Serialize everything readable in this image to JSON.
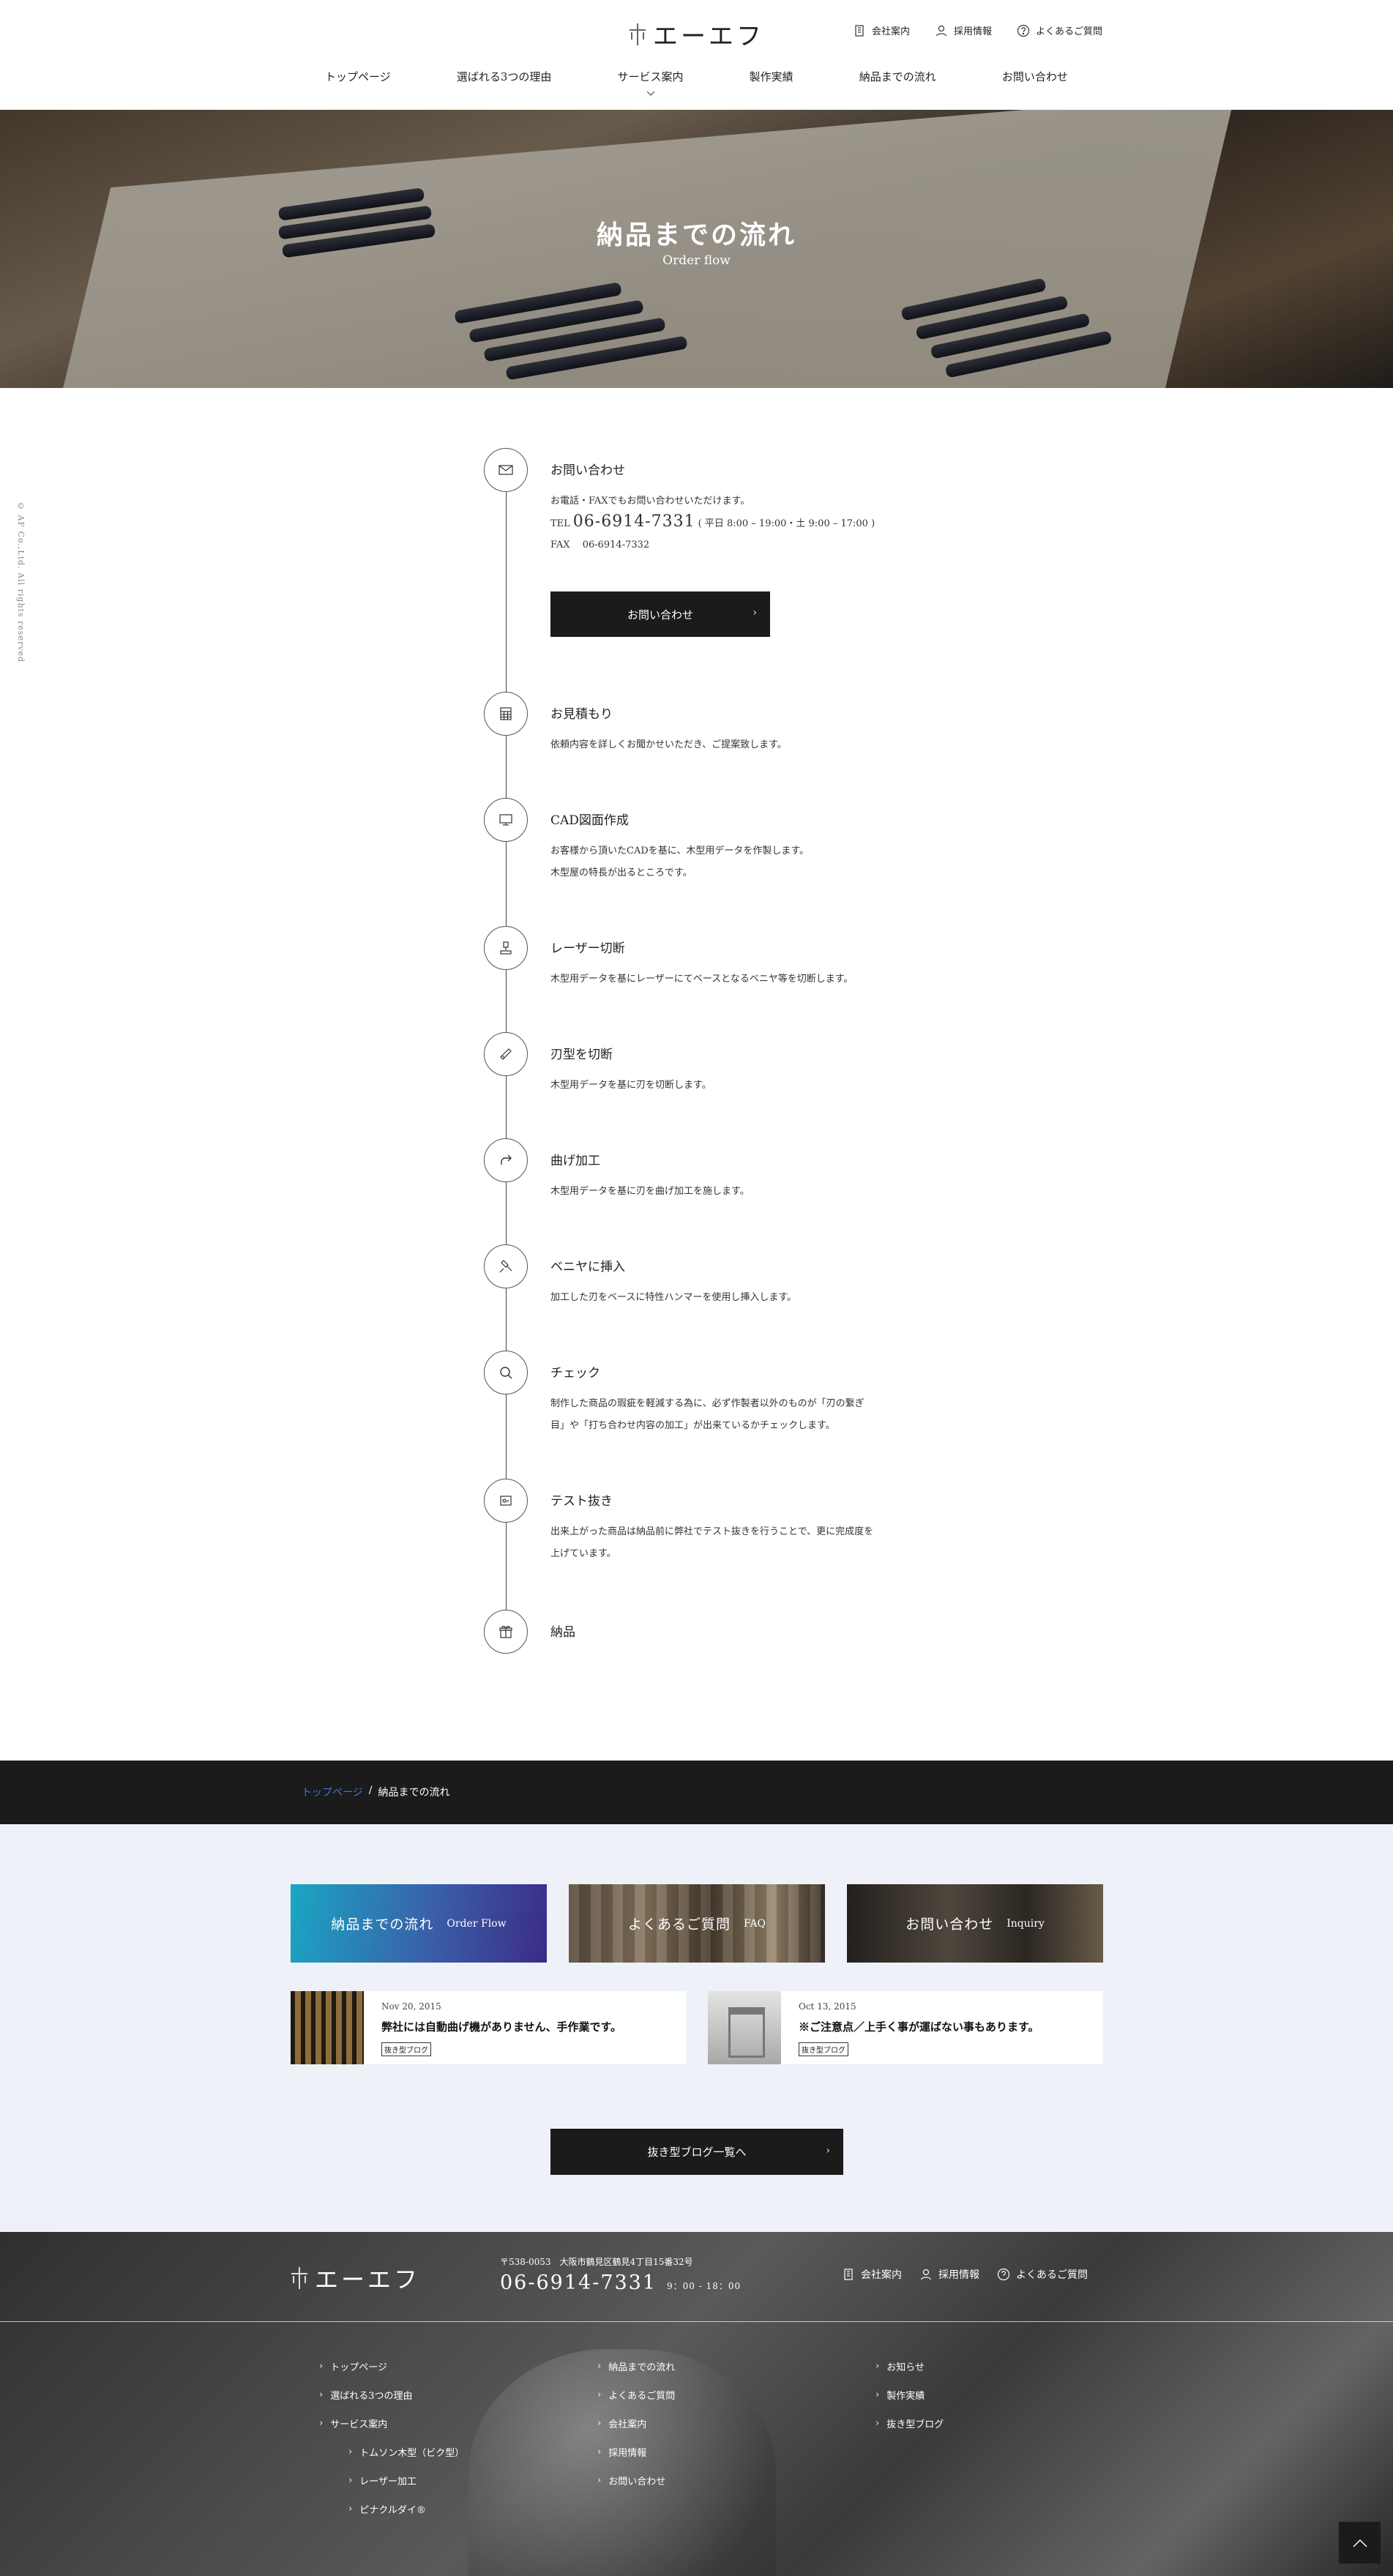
{
  "header": {
    "logo_text": "エーエフ",
    "util_links": [
      {
        "label": "会社案内",
        "icon": "building-icon"
      },
      {
        "label": "採用情報",
        "icon": "person-icon"
      },
      {
        "label": "よくあるご質問",
        "icon": "question-circle-icon"
      }
    ],
    "nav": [
      {
        "label": "トップページ"
      },
      {
        "label": "選ばれる3つの理由"
      },
      {
        "label": "サービス案内"
      },
      {
        "label": "製作実績"
      },
      {
        "label": "納品までの流れ"
      },
      {
        "label": "お問い合わせ"
      }
    ]
  },
  "hero": {
    "title": "納品までの流れ",
    "subtitle": "Order flow"
  },
  "side_copyright": "© AF Co.,Ltd. All rights reserved",
  "steps": [
    {
      "title": "お問い合わせ",
      "icon": "envelope-icon",
      "intro": "お電話・FAXでもお問い合わせいただけます。",
      "tel_label": "TEL",
      "tel_number": "06-6914-7331",
      "tel_hours": "( 平日 8:00 – 19:00・土 9:00 – 17:00 )",
      "fax_label": "FAX",
      "fax_number": "06-6914-7332",
      "button_label": "お問い合わせ"
    },
    {
      "title": "お見積もり",
      "icon": "calculator-icon",
      "desc": "依頼内容を詳しくお聞かせいただき、ご提案致します。"
    },
    {
      "title": "CAD図面作成",
      "icon": "monitor-icon",
      "desc": "お客様から頂いたCADを基に、木型用データを作製します。",
      "desc2": "木型屋の特長が出るところです。"
    },
    {
      "title": "レーザー切断",
      "icon": "laser-icon",
      "desc": "木型用データを基にレーザーにてベースとなるベニヤ等を切断します。"
    },
    {
      "title": "刃型を切断",
      "icon": "blade-icon",
      "desc": "木型用データを基に刃を切断します。"
    },
    {
      "title": "曲げ加工",
      "icon": "bend-arrow-icon",
      "desc": "木型用データを基に刃を曲げ加工を施します。"
    },
    {
      "title": "ベニヤに挿入",
      "icon": "hammer-icon",
      "desc": "加工した刃をベースに特性ハンマーを使用し挿入します。"
    },
    {
      "title": "チェック",
      "icon": "magnifier-icon",
      "desc": "制作した商品の瑕疵を軽減する為に、必ず作製者以外のものが「刃の繋ぎ",
      "desc2": "目」や「打ち合わせ内容の加工」が出来ているかチェックします。"
    },
    {
      "title": "テスト抜き",
      "icon": "test-cut-icon",
      "desc": "出来上がった商品は納品前に弊社でテスト抜きを行うことで、更に完成度を",
      "desc2": "上げています。"
    },
    {
      "title": "納品",
      "icon": "gift-icon"
    }
  ],
  "breadcrumb": {
    "home": "トップページ",
    "separator": "/",
    "current": "納品までの流れ"
  },
  "banners": [
    {
      "title": "納品までの流れ",
      "en": "Order Flow"
    },
    {
      "title": "よくあるご質問",
      "en": "FAQ"
    },
    {
      "title": "お問い合わせ",
      "en": "Inquiry"
    }
  ],
  "posts": [
    {
      "date": "Nov 20, 2015",
      "title": "弊社には自動曲げ機がありません、手作業です。",
      "tag": "抜き型ブログ"
    },
    {
      "date": "Oct 13, 2015",
      "title": "※ご注意点／上手く事が運ばない事もあります。",
      "tag": "抜き型ブログ"
    }
  ],
  "blog_button": "抜き型ブログ一覧へ",
  "footer": {
    "logo_text": "エーエフ",
    "address": "〒538-0053　大阪市鶴見区鶴見4丁目15番32号",
    "tel": "06-6914-7331",
    "hours": "9：00 - 18：00",
    "util_links": [
      {
        "label": "会社案内",
        "icon": "building-icon"
      },
      {
        "label": "採用情報",
        "icon": "person-icon"
      },
      {
        "label": "よくあるご質問",
        "icon": "question-circle-icon"
      }
    ],
    "col1": [
      {
        "label": "トップページ"
      },
      {
        "label": "選ばれる3つの理由"
      },
      {
        "label": "サービス案内"
      },
      {
        "label": "トムソン木型（ビク型）",
        "sub": true
      },
      {
        "label": "レーザー加工",
        "sub": true
      },
      {
        "label": "ピナクルダイ®",
        "sub": true
      }
    ],
    "col2": [
      {
        "label": "納品までの流れ"
      },
      {
        "label": "よくあるご質問"
      },
      {
        "label": "会社案内"
      },
      {
        "label": "採用情報"
      },
      {
        "label": "お問い合わせ"
      }
    ],
    "col3": [
      {
        "label": "お知らせ"
      },
      {
        "label": "製作実績"
      },
      {
        "label": "抜き型ブログ"
      }
    ]
  },
  "page_top_icon": "chevron-up-icon"
}
